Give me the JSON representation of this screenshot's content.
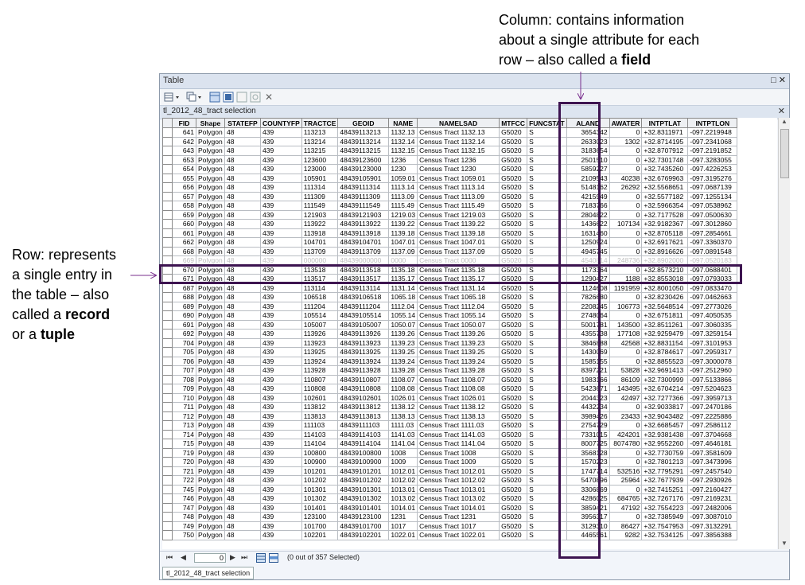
{
  "annotations": {
    "column_text_1": "Column: contains information",
    "column_text_2": "about a single attribute for each",
    "column_text_3a": "row – also called a ",
    "column_text_3b": "field",
    "row_text_1": "Row: represents",
    "row_text_2": "a single entry in",
    "row_text_3": "the table – also",
    "row_text_4a": "called a ",
    "row_text_4b": "record",
    "row_text_5a": "or a ",
    "row_text_5b": "tuple"
  },
  "window": {
    "title": "Table",
    "layer_tab": "tl_2012_48_tract selection",
    "bottom_tab": "tl_2012_48_tract selection",
    "record_number": "0",
    "status": "(0 out of 357 Selected)"
  },
  "icons": {
    "table_options": "table-options-icon",
    "related_tables": "related-tables-icon",
    "select_by_attributes": "select-by-attributes-icon",
    "switch_selection": "switch-selection-icon",
    "clear_selection": "clear-selection-icon",
    "zoom_to_selected": "zoom-to-selected-icon",
    "delete_selected": "delete-selected-icon"
  },
  "table": {
    "columns": [
      "FID",
      "Shape",
      "STATEFP",
      "COUNTYFP",
      "TRACTCE",
      "GEOID",
      "NAME",
      "NAMELSAD",
      "MTFCC",
      "FUNCSTAT",
      "ALAND",
      "AWATER",
      "INTPTLAT",
      "INTPTLON"
    ],
    "rows": [
      [
        "641",
        "Polygon",
        "48",
        "439",
        "113213",
        "48439113213",
        "1132.13",
        "Census Tract 1132.13",
        "G5020",
        "S",
        "3654342",
        "0",
        "+32.8311971",
        "-097.2219948"
      ],
      [
        "642",
        "Polygon",
        "48",
        "439",
        "113214",
        "48439113214",
        "1132.14",
        "Census Tract 1132.14",
        "G5020",
        "S",
        "2633023",
        "1302",
        "+32.8714195",
        "-097.2341068"
      ],
      [
        "643",
        "Polygon",
        "48",
        "439",
        "113215",
        "48439113215",
        "1132.15",
        "Census Tract 1132.15",
        "G5020",
        "S",
        "3183654",
        "0",
        "+32.8707912",
        "-097.2191852"
      ],
      [
        "653",
        "Polygon",
        "48",
        "439",
        "123600",
        "48439123600",
        "1236",
        "Census Tract 1236",
        "G5020",
        "S",
        "2501510",
        "0",
        "+32.7301748",
        "-097.3283055"
      ],
      [
        "654",
        "Polygon",
        "48",
        "439",
        "123000",
        "48439123000",
        "1230",
        "Census Tract 1230",
        "G5020",
        "S",
        "5859227",
        "0",
        "+32.7435260",
        "-097.4226253"
      ],
      [
        "655",
        "Polygon",
        "48",
        "439",
        "105901",
        "48439105901",
        "1059.01",
        "Census Tract 1059.01",
        "G5020",
        "S",
        "2109543",
        "40238",
        "+32.6769963",
        "-097.3195276"
      ],
      [
        "656",
        "Polygon",
        "48",
        "439",
        "111314",
        "48439111314",
        "1113.14",
        "Census Tract 1113.14",
        "G5020",
        "S",
        "5148162",
        "26292",
        "+32.5568651",
        "-097.0687139"
      ],
      [
        "657",
        "Polygon",
        "48",
        "439",
        "111309",
        "48439111309",
        "1113.09",
        "Census Tract 1113.09",
        "G5020",
        "S",
        "4215949",
        "0",
        "+32.5577182",
        "-097.1255134"
      ],
      [
        "658",
        "Polygon",
        "48",
        "439",
        "111549",
        "48439111549",
        "1115.49",
        "Census Tract 1115.49",
        "G5020",
        "S",
        "7183766",
        "0",
        "+32.5966354",
        "-097.0538962"
      ],
      [
        "659",
        "Polygon",
        "48",
        "439",
        "121903",
        "48439121903",
        "1219.03",
        "Census Tract 1219.03",
        "G5020",
        "S",
        "2804822",
        "0",
        "+32.7177528",
        "-097.0500630"
      ],
      [
        "660",
        "Polygon",
        "48",
        "439",
        "113922",
        "48439113922",
        "1139.22",
        "Census Tract 1139.22",
        "G5020",
        "S",
        "1436622",
        "107134",
        "+32.9182367",
        "-097.3012860"
      ],
      [
        "661",
        "Polygon",
        "48",
        "439",
        "113918",
        "48439113918",
        "1139.18",
        "Census Tract 1139.18",
        "G5020",
        "S",
        "1631460",
        "0",
        "+32.8705118",
        "-097.2854661"
      ],
      [
        "662",
        "Polygon",
        "48",
        "439",
        "104701",
        "48439104701",
        "1047.01",
        "Census Tract 1047.01",
        "G5020",
        "S",
        "1250924",
        "0",
        "+32.6917621",
        "-097.3360370"
      ],
      [
        "668",
        "Polygon",
        "48",
        "439",
        "113709",
        "48439113709",
        "1137.09",
        "Census Tract 1137.09",
        "G5020",
        "S",
        "4945745",
        "0",
        "+32.8916626",
        "-097.0891548"
      ],
      [
        "669",
        "Polygon",
        "48",
        "439",
        "000000",
        "48439000000",
        "0000",
        "Census Tract 0000",
        "G5020",
        "S",
        "4540814",
        "248736",
        "+32.8902000",
        "-097.0520183"
      ],
      [
        "670",
        "Polygon",
        "48",
        "439",
        "113518",
        "48439113518",
        "1135.18",
        "Census Tract 1135.18",
        "G5020",
        "S",
        "1173364",
        "0",
        "+32.8573210",
        "-097.0688401"
      ],
      [
        "671",
        "Polygon",
        "48",
        "439",
        "113517",
        "48439113517",
        "1135.17",
        "Census Tract 1135.17",
        "G5020",
        "S",
        "1290427",
        "1188",
        "+32.8553018",
        "-097.0793033"
      ],
      [
        "687",
        "Polygon",
        "48",
        "439",
        "113114",
        "48439113114",
        "1131.14",
        "Census Tract 1131.14",
        "G5020",
        "S",
        "1124608",
        "1191959",
        "+32.8001050",
        "-097.0833470"
      ],
      [
        "688",
        "Polygon",
        "48",
        "439",
        "106518",
        "48439106518",
        "1065.18",
        "Census Tract 1065.18",
        "G5020",
        "S",
        "7826680",
        "0",
        "+32.8230426",
        "-097.0462663"
      ],
      [
        "689",
        "Polygon",
        "48",
        "439",
        "111204",
        "48439111204",
        "1112.04",
        "Census Tract 1112.04",
        "G5020",
        "S",
        "2208245",
        "106773",
        "+32.5648514",
        "-097.2773026"
      ],
      [
        "690",
        "Polygon",
        "48",
        "439",
        "105514",
        "48439105514",
        "1055.14",
        "Census Tract 1055.14",
        "G5020",
        "S",
        "2748064",
        "0",
        "+32.6751811",
        "-097.4050535"
      ],
      [
        "691",
        "Polygon",
        "48",
        "439",
        "105007",
        "48439105007",
        "1050.07",
        "Census Tract 1050.07",
        "G5020",
        "S",
        "5001781",
        "143500",
        "+32.8511261",
        "-097.3060335"
      ],
      [
        "692",
        "Polygon",
        "48",
        "439",
        "113926",
        "48439113926",
        "1139.26",
        "Census Tract 1139.26",
        "G5020",
        "S",
        "4355738",
        "177108",
        "+32.9259479",
        "-097.3259154"
      ],
      [
        "704",
        "Polygon",
        "48",
        "439",
        "113923",
        "48439113923",
        "1139.23",
        "Census Tract 1139.23",
        "G5020",
        "S",
        "3846888",
        "42568",
        "+32.8831154",
        "-097.3101953"
      ],
      [
        "705",
        "Polygon",
        "48",
        "439",
        "113925",
        "48439113925",
        "1139.25",
        "Census Tract 1139.25",
        "G5020",
        "S",
        "1430069",
        "0",
        "+32.8784617",
        "-097.2959317"
      ],
      [
        "706",
        "Polygon",
        "48",
        "439",
        "113924",
        "48439113924",
        "1139.24",
        "Census Tract 1139.24",
        "G5020",
        "S",
        "1585155",
        "0",
        "+32.8855523",
        "-097.3000078"
      ],
      [
        "707",
        "Polygon",
        "48",
        "439",
        "113928",
        "48439113928",
        "1139.28",
        "Census Tract 1139.28",
        "G5020",
        "S",
        "8397221",
        "53828",
        "+32.9691413",
        "-097.2512960"
      ],
      [
        "708",
        "Polygon",
        "48",
        "439",
        "110807",
        "48439110807",
        "1108.07",
        "Census Tract 1108.07",
        "G5020",
        "S",
        "1983166",
        "86109",
        "+32.7300999",
        "-097.5133866"
      ],
      [
        "709",
        "Polygon",
        "48",
        "439",
        "110808",
        "48439110808",
        "1108.08",
        "Census Tract 1108.08",
        "G5020",
        "S",
        "5423671",
        "143495",
        "+32.6704214",
        "-097.5204623"
      ],
      [
        "710",
        "Polygon",
        "48",
        "439",
        "102601",
        "48439102601",
        "1026.01",
        "Census Tract 1026.01",
        "G5020",
        "S",
        "2044323",
        "42497",
        "+32.7277366",
        "-097.3959713"
      ],
      [
        "711",
        "Polygon",
        "48",
        "439",
        "113812",
        "48439113812",
        "1138.12",
        "Census Tract 1138.12",
        "G5020",
        "S",
        "4432234",
        "0",
        "+32.9033817",
        "-097.2470186"
      ],
      [
        "712",
        "Polygon",
        "48",
        "439",
        "113813",
        "48439113813",
        "1138.13",
        "Census Tract 1138.13",
        "G5020",
        "S",
        "3989426",
        "23433",
        "+32.9043482",
        "-097.2225886"
      ],
      [
        "713",
        "Polygon",
        "48",
        "439",
        "111103",
        "48439111103",
        "1111.03",
        "Census Tract 1111.03",
        "G5020",
        "S",
        "2754729",
        "0",
        "+32.6685457",
        "-097.2586112"
      ],
      [
        "714",
        "Polygon",
        "48",
        "439",
        "114103",
        "48439114103",
        "1141.03",
        "Census Tract 1141.03",
        "G5020",
        "S",
        "7331015",
        "424201",
        "+32.9381438",
        "-097.3704668"
      ],
      [
        "715",
        "Polygon",
        "48",
        "439",
        "114104",
        "48439114104",
        "1141.04",
        "Census Tract 1141.04",
        "G5020",
        "S",
        "8007725",
        "8074780",
        "+32.9552260",
        "-097.4646181"
      ],
      [
        "719",
        "Polygon",
        "48",
        "439",
        "100800",
        "48439100800",
        "1008",
        "Census Tract 1008",
        "G5020",
        "S",
        "3568128",
        "0",
        "+32.7730759",
        "-097.3581609"
      ],
      [
        "720",
        "Polygon",
        "48",
        "439",
        "100900",
        "48439100900",
        "1009",
        "Census Tract 1009",
        "G5020",
        "S",
        "1570223",
        "0",
        "+32.7801213",
        "-097.3473996"
      ],
      [
        "721",
        "Polygon",
        "48",
        "439",
        "101201",
        "48439101201",
        "1012.01",
        "Census Tract 1012.01",
        "G5020",
        "S",
        "1747714",
        "532516",
        "+32.7795291",
        "-097.2457540"
      ],
      [
        "722",
        "Polygon",
        "48",
        "439",
        "101202",
        "48439101202",
        "1012.02",
        "Census Tract 1012.02",
        "G5020",
        "S",
        "5470896",
        "25964",
        "+32.7677939",
        "-097.2930926"
      ],
      [
        "745",
        "Polygon",
        "48",
        "439",
        "101301",
        "48439101301",
        "1013.01",
        "Census Tract 1013.01",
        "G5020",
        "S",
        "3306869",
        "0",
        "+32.7415251",
        "-097.2160427"
      ],
      [
        "746",
        "Polygon",
        "48",
        "439",
        "101302",
        "48439101302",
        "1013.02",
        "Census Tract 1013.02",
        "G5020",
        "S",
        "4286025",
        "684765",
        "+32.7267176",
        "-097.2169231"
      ],
      [
        "747",
        "Polygon",
        "48",
        "439",
        "101401",
        "48439101401",
        "1014.01",
        "Census Tract 1014.01",
        "G5020",
        "S",
        "3859421",
        "47192",
        "+32.7554223",
        "-097.2482006"
      ],
      [
        "748",
        "Polygon",
        "48",
        "439",
        "123100",
        "48439123100",
        "1231",
        "Census Tract 1231",
        "G5020",
        "S",
        "3956317",
        "0",
        "+32.7385949",
        "-097.3087010"
      ],
      [
        "749",
        "Polygon",
        "48",
        "439",
        "101700",
        "48439101700",
        "1017",
        "Census Tract 1017",
        "G5020",
        "S",
        "3129310",
        "86427",
        "+32.7547953",
        "-097.3132291"
      ],
      [
        "750",
        "Polygon",
        "48",
        "439",
        "102201",
        "48439102201",
        "1022.01",
        "Census Tract 1022.01",
        "G5020",
        "S",
        "4465561",
        "9282",
        "+32.7534125",
        "-097.3856388"
      ]
    ]
  }
}
